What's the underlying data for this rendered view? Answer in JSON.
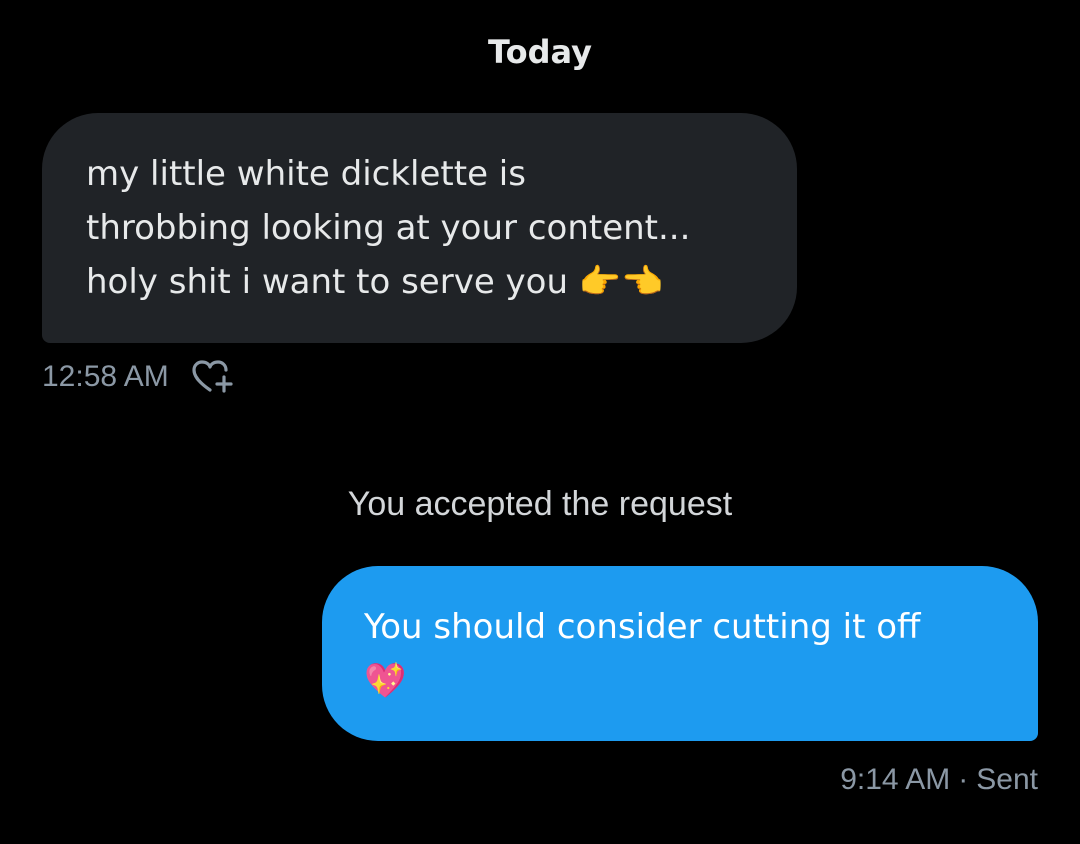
{
  "header": {
    "date_label": "Today"
  },
  "messages": [
    {
      "direction": "incoming",
      "text": "my little white dicklette is\nthrobbing looking at your content...\nholy shit i want to serve you 👉👈",
      "time": "12:58 AM",
      "react_icon": "heart-plus-icon"
    },
    {
      "direction": "outgoing",
      "text": "You should consider cutting it off\n💖",
      "time": "9:14 AM",
      "separator": "·",
      "status": "Sent"
    }
  ],
  "system": {
    "request_notice": "You accepted the request"
  },
  "colors": {
    "background": "#000000",
    "incoming_bubble": "#202327",
    "outgoing_bubble": "#1d9bf0",
    "meta_text": "#8b98a5"
  }
}
